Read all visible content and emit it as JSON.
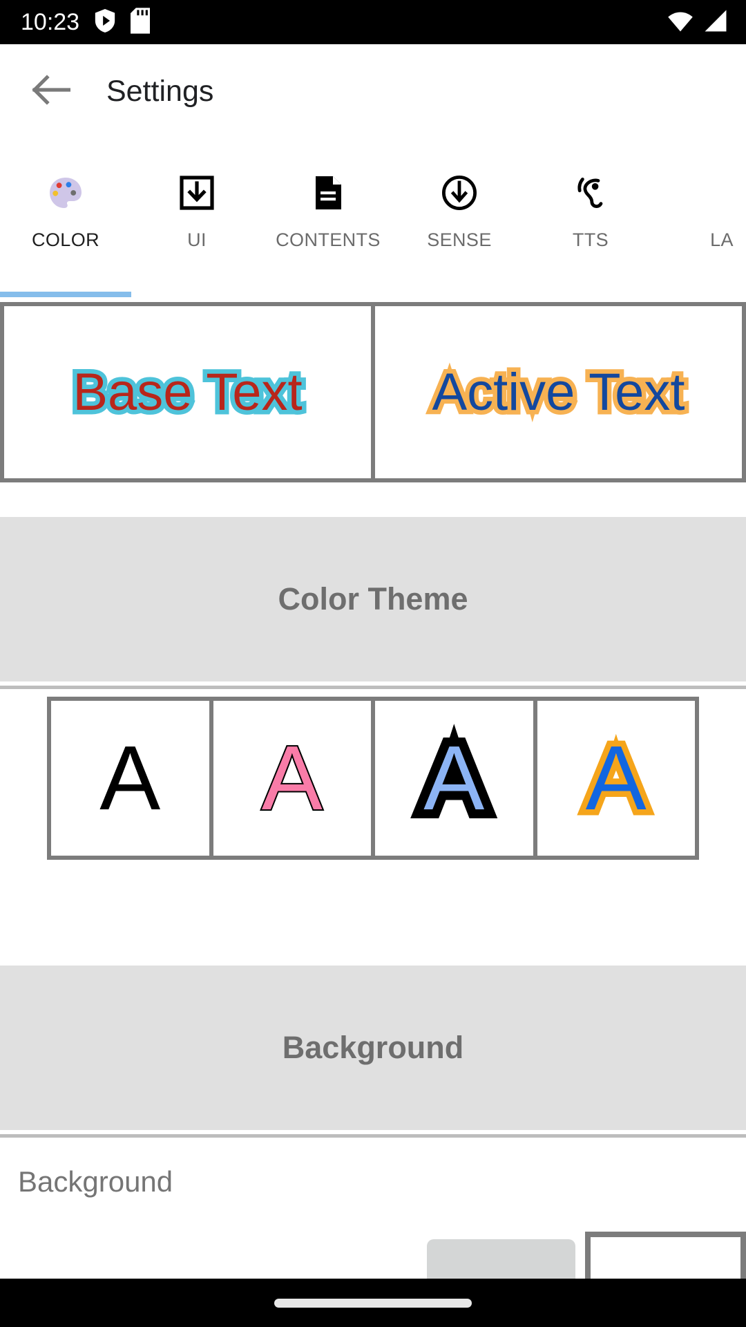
{
  "status_bar": {
    "clock": "10:23",
    "left_icons": [
      {
        "name": "play-protect-shield-icon"
      },
      {
        "name": "sd-card-icon"
      }
    ],
    "right_icons": [
      {
        "name": "wifi-icon"
      },
      {
        "name": "cellular-signal-icon"
      }
    ],
    "background_color": "#000000",
    "foreground_color": "#ffffff"
  },
  "app_bar": {
    "back_icon": "back-arrow-icon",
    "title": "Settings",
    "title_color": "#202124"
  },
  "tabs": {
    "active_index": 0,
    "indicator_color": "#85bdeb",
    "active_label_color": "#1f1f1f",
    "inactive_label_color": "#6b6b6b",
    "items": [
      {
        "label": "COLOR",
        "icon": "palette-icon",
        "active": true
      },
      {
        "label": "UI",
        "icon": "download-box-icon",
        "active": false
      },
      {
        "label": "CONTENTS",
        "icon": "document-icon",
        "active": false
      },
      {
        "label": "SENSE",
        "icon": "download-circle-icon",
        "active": false
      },
      {
        "label": "TTS",
        "icon": "ear-hearing-icon",
        "active": false
      },
      {
        "label": "LA",
        "icon": "none",
        "active": false
      }
    ]
  },
  "preview": {
    "frame_color": "#7c7c7c",
    "items": [
      {
        "name": "base-text-preview",
        "text": "Base Text",
        "fill_color": "#b8261b",
        "outline_color": "#4ec3da"
      },
      {
        "name": "active-text-preview",
        "text": "Active Text",
        "fill_color": "#13489e",
        "outline_color": "#f7b253"
      }
    ]
  },
  "sections": {
    "color_theme": {
      "title": "Color Theme",
      "band_color": "#e0e0e0",
      "title_color": "#6e6e6e",
      "swatches": [
        {
          "name": "theme-swatch-black",
          "glyph": "A",
          "fill_color": "#000000",
          "outline_color": "none"
        },
        {
          "name": "theme-swatch-pink",
          "glyph": "A",
          "fill_color": "#f97ca8",
          "outline_color": "#000000"
        },
        {
          "name": "theme-swatch-blue-black",
          "glyph": "A",
          "fill_color": "#8cb4f5",
          "outline_color": "#000000"
        },
        {
          "name": "theme-swatch-blue-orange",
          "glyph": "A",
          "fill_color": "#1166e0",
          "outline_color": "#f5a51b"
        }
      ]
    },
    "background": {
      "title": "Background",
      "band_color": "#e0e0e0",
      "title_color": "#6e6e6e",
      "row_label": "Background",
      "row_label_color": "#757575",
      "swatches": [
        {
          "name": "background-swatch-gray",
          "color": "#d4d6d6"
        },
        {
          "name": "background-swatch-white",
          "color": "#ffffff"
        }
      ]
    }
  },
  "nav_bar": {
    "gesture_pill": "home-gesture-pill",
    "background_color": "#000000"
  }
}
